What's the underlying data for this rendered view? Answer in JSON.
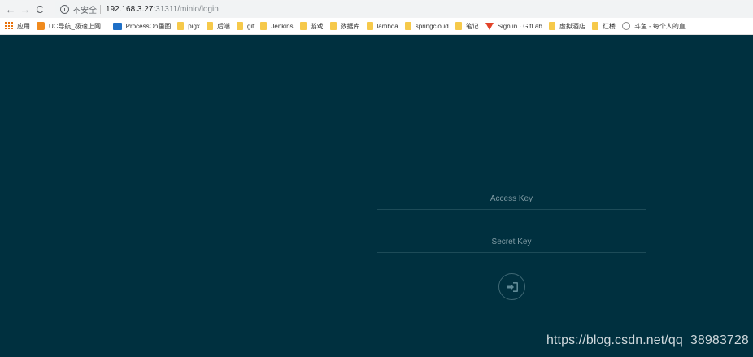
{
  "browser": {
    "back_glyph": "←",
    "forward_glyph": "→",
    "reload_glyph": "C",
    "insecure_label": "不安全",
    "url_host": "192.168.3.27",
    "url_path": ":31311/minio/login"
  },
  "bookmarks": [
    {
      "label": "应用",
      "icon": "apps-icon"
    },
    {
      "label": "UC导航_极速上网...",
      "icon": "uc-icon"
    },
    {
      "label": "ProcessOn画图",
      "icon": "processon-icon"
    },
    {
      "label": "pigx",
      "icon": "folder-icon"
    },
    {
      "label": "后端",
      "icon": "folder-icon"
    },
    {
      "label": "git",
      "icon": "folder-icon"
    },
    {
      "label": "Jenkins",
      "icon": "folder-icon"
    },
    {
      "label": "游戏",
      "icon": "folder-icon"
    },
    {
      "label": "数据库",
      "icon": "folder-icon"
    },
    {
      "label": "lambda",
      "icon": "folder-icon"
    },
    {
      "label": "springcloud",
      "icon": "folder-icon"
    },
    {
      "label": "笔记",
      "icon": "folder-icon"
    },
    {
      "label": "Sign in · GitLab",
      "icon": "gitlab-icon"
    },
    {
      "label": "虚拟酒店",
      "icon": "folder-icon"
    },
    {
      "label": "红楼",
      "icon": "folder-icon"
    },
    {
      "label": "斗鱼 - 每个人的直",
      "icon": "douyu-icon"
    }
  ],
  "login": {
    "access_key_placeholder": "Access Key",
    "secret_key_placeholder": "Secret Key",
    "submit_icon": "sign-in-icon"
  },
  "watermark": "https://blog.csdn.net/qq_38983728",
  "colors": {
    "background": "#00303f",
    "input_underline": "#1d4b58",
    "placeholder": "#7f9aa3"
  }
}
